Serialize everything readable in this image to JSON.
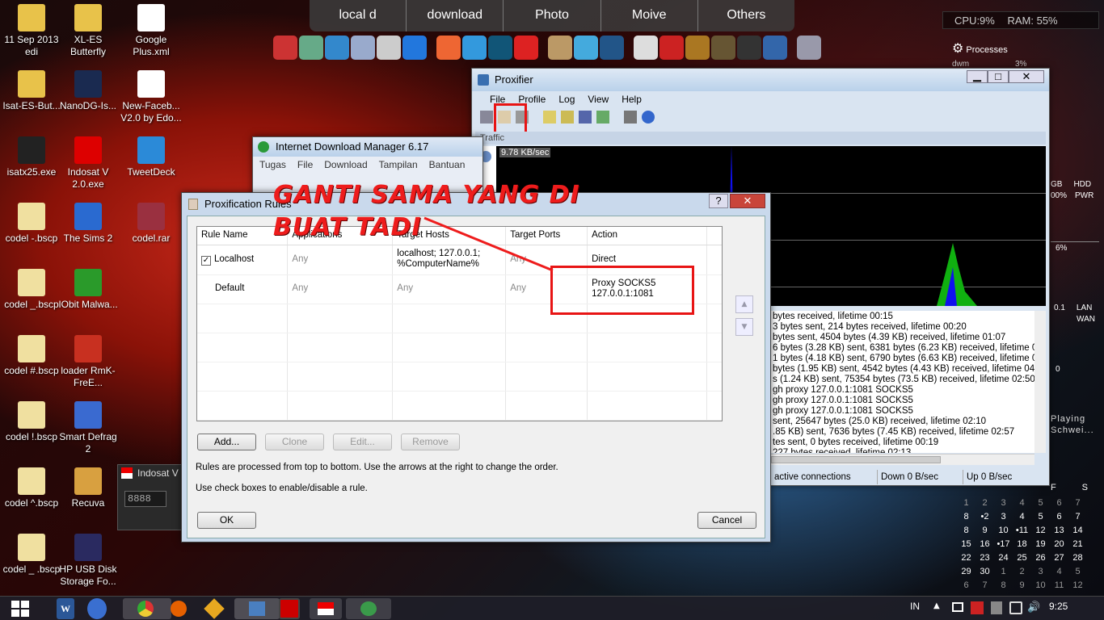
{
  "desktop_icons": [
    {
      "label": "11 Sep 2013 edi"
    },
    {
      "label": "XL-ES Butterfly"
    },
    {
      "label": "Google Plus.xml"
    },
    {
      "label": "Isat-ES-But..."
    },
    {
      "label": "NanoDG-Is..."
    },
    {
      "label": "New-Faceb... V2.0 by Edo..."
    },
    {
      "label": "isatx25.exe"
    },
    {
      "label": "Indosat V 2.0.exe"
    },
    {
      "label": "TweetDeck"
    },
    {
      "label": "codel -.bscp"
    },
    {
      "label": "The Sims 2"
    },
    {
      "label": "codel.rar"
    },
    {
      "label": "codel _.bscp"
    },
    {
      "label": "IObit Malwa..."
    },
    {
      "label": "codel #.bscp"
    },
    {
      "label": "loader RmK-FreE..."
    },
    {
      "label": "codel !.bscp"
    },
    {
      "label": "Smart Defrag 2"
    },
    {
      "label": "codel ^.bscp"
    },
    {
      "label": "Recuva"
    },
    {
      "label": "codel _ .bscp"
    },
    {
      "label": "HP USB Disk Storage Fo..."
    }
  ],
  "topbar": [
    "local d",
    "download",
    "Photo",
    "Moive",
    "Others"
  ],
  "proxifier": {
    "title": "Proxifier",
    "menu": [
      "File",
      "Profile",
      "Log",
      "View",
      "Help"
    ],
    "traffic_label": "Traffic",
    "rate": "9.78 KB/sec",
    "log_lines": [
      "bytes received, lifetime 00:15",
      "3 bytes sent, 214 bytes received, lifetime 00:20",
      "bytes sent, 4504 bytes (4.39 KB) received, lifetime 01:07",
      "6 bytes (3.28 KB) sent, 6381 bytes (6.23 KB) received, lifetime 01:34",
      "1 bytes (4.18 KB) sent, 6790 bytes (6.63 KB) received, lifetime 02:23",
      "bytes (1.95 KB) sent, 4542 bytes (4.43 KB) received, lifetime 04:26",
      "s (1.24 KB) sent, 75354 bytes (73.5 KB) received, lifetime 02:50",
      "gh proxy 127.0.0.1:1081 SOCKS5",
      "gh proxy 127.0.0.1:1081 SOCKS5",
      "gh proxy 127.0.0.1:1081 SOCKS5",
      "sent, 25647 bytes (25.0 KB) received, lifetime 02:10",
      ".85 KB) sent, 7636 bytes (7.45 KB) received, lifetime 02:57",
      "tes sent, 0 bytes received, lifetime 00:19",
      "227 bytes received, lifetime 02:13"
    ],
    "status": {
      "connections": "active connections",
      "down": "Down 0 B/sec",
      "up": "Up 0 B/sec"
    }
  },
  "idm": {
    "title": "Internet Download Manager 6.17",
    "menu": [
      "Tugas",
      "File",
      "Download",
      "Tampilan",
      "Bantuan"
    ]
  },
  "dialog": {
    "title": "Proxification Rules",
    "columns": [
      "Rule Name",
      "Applications",
      "Target Hosts",
      "Target Ports",
      "Action"
    ],
    "rules": [
      {
        "name": "Localhost",
        "apps": "Any",
        "hosts": "localhost; 127.0.0.1; %ComputerName%",
        "ports": "Any",
        "action": "Direct"
      },
      {
        "name": "Default",
        "apps": "Any",
        "hosts": "Any",
        "ports": "Any",
        "action": "Proxy SOCKS5 127.0.0.1:1081"
      }
    ],
    "buttons": {
      "add": "Add...",
      "clone": "Clone",
      "edit": "Edit...",
      "remove": "Remove",
      "ok": "OK",
      "cancel": "Cancel"
    },
    "note1": "Rules are processed from top to bottom. Use the arrows at the right to change the order.",
    "note2": "Use check boxes to enable/disable a rule."
  },
  "annotation": {
    "line1": "GANTI SAMA YANG DI",
    "line2": "BUAT TADI",
    "color": "#ee1c1c"
  },
  "indosat": {
    "title": "Indosat V",
    "value": "8888"
  },
  "widget": {
    "cpu": "CPU:9%",
    "ram": "RAM: 55%",
    "processes": "Processes",
    "dwm": "dwm",
    "pct": "3%",
    "gb": "GB",
    "pct00": "00%",
    "hdd": "HDD",
    "pwr": "PWR",
    "six": "6%",
    "n01": "0.1",
    "lan": "LAN",
    "wan": "WAN",
    "zero": "0",
    "playing": "Playing",
    "schwei": "Schwei..."
  },
  "calendar": {
    "header": [
      "F",
      "S"
    ],
    "rows": [
      [
        "1",
        "2",
        "3",
        "4",
        "5",
        "6",
        "7"
      ],
      [
        "8",
        "•2",
        "3",
        "4",
        "5",
        "6",
        "7"
      ],
      [
        "8",
        "9",
        "10",
        "•11",
        "12",
        "13",
        "14"
      ],
      [
        "15",
        "16",
        "•17",
        "18",
        "19",
        "20",
        "21"
      ],
      [
        "22",
        "23",
        "24",
        "25",
        "26",
        "27",
        "28"
      ],
      [
        "29",
        "30",
        "1",
        "2",
        "3",
        "4",
        "5"
      ],
      [
        "6",
        "7",
        "8",
        "9",
        "10",
        "11",
        "12"
      ]
    ]
  },
  "taskbar": {
    "lang": "IN",
    "time": "9:25"
  }
}
